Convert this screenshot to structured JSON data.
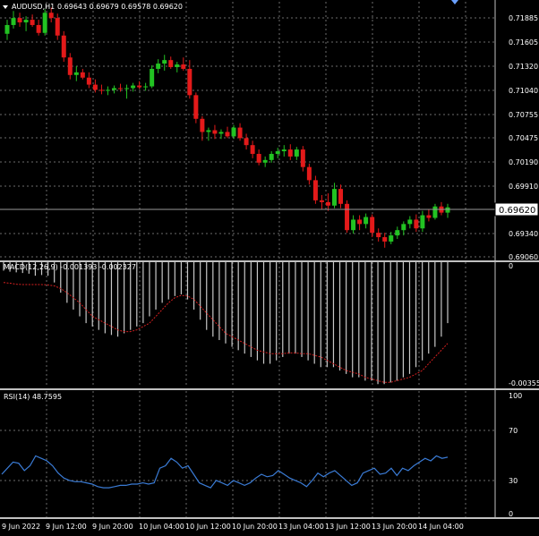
{
  "window": {
    "symbol": "AUDUSD,H1",
    "ohlc": "0.69643 0.69679 0.69578 0.69620",
    "current_price": "0.69620"
  },
  "colors": {
    "background": "#000000",
    "grid": "#6b6b6b",
    "bull": "#22c322",
    "bear": "#e31a1a",
    "macd_hist": "#c8c8c8",
    "macd_signal": "#d42020",
    "rsi_line": "#3a7bd5",
    "price_line": "#9a9a9a"
  },
  "price_axis": [
    "0.71885",
    "0.71605",
    "0.71320",
    "0.71040",
    "0.70755",
    "0.70475",
    "0.70190",
    "0.69910",
    "0.69340",
    "0.69060"
  ],
  "time_axis": [
    "9 Jun 2022",
    "9 Jun 12:00",
    "9 Jun 20:00",
    "10 Jun 04:00",
    "10 Jun 12:00",
    "10 Jun 20:00",
    "13 Jun 04:00",
    "13 Jun 12:00",
    "13 Jun 20:00",
    "14 Jun 04:00"
  ],
  "macd": {
    "label": "MACD(12,26,9) -0.001393 -0.002327",
    "top_label": "0",
    "bottom_label": "-0.00355"
  },
  "rsi": {
    "label": "RSI(14) 48.7595",
    "levels": [
      "100",
      "70",
      "30",
      "0"
    ]
  },
  "chart_data": [
    {
      "type": "candlestick",
      "title": "AUDUSD,H1",
      "ylim": [
        0.69035,
        0.71985
      ],
      "candles": [
        {
          "o": 0.7162,
          "h": 0.7178,
          "l": 0.7155,
          "c": 0.7172
        },
        {
          "o": 0.7172,
          "h": 0.7188,
          "l": 0.7168,
          "c": 0.718
        },
        {
          "o": 0.718,
          "h": 0.7186,
          "l": 0.717,
          "c": 0.7175
        },
        {
          "o": 0.7175,
          "h": 0.7182,
          "l": 0.7165,
          "c": 0.7178
        },
        {
          "o": 0.7178,
          "h": 0.7184,
          "l": 0.717,
          "c": 0.7172
        },
        {
          "o": 0.7172,
          "h": 0.7178,
          "l": 0.716,
          "c": 0.7163
        },
        {
          "o": 0.7163,
          "h": 0.719,
          "l": 0.716,
          "c": 0.7186
        },
        {
          "o": 0.7186,
          "h": 0.7192,
          "l": 0.7175,
          "c": 0.718
        },
        {
          "o": 0.718,
          "h": 0.7185,
          "l": 0.7155,
          "c": 0.716
        },
        {
          "o": 0.716,
          "h": 0.7165,
          "l": 0.713,
          "c": 0.7135
        },
        {
          "o": 0.7135,
          "h": 0.714,
          "l": 0.711,
          "c": 0.7115
        },
        {
          "o": 0.7115,
          "h": 0.7125,
          "l": 0.7108,
          "c": 0.7118
        },
        {
          "o": 0.7118,
          "h": 0.7122,
          "l": 0.711,
          "c": 0.7112
        },
        {
          "o": 0.7112,
          "h": 0.7118,
          "l": 0.71,
          "c": 0.7104
        },
        {
          "o": 0.7104,
          "h": 0.711,
          "l": 0.7095,
          "c": 0.7098
        },
        {
          "o": 0.7098,
          "h": 0.7104,
          "l": 0.7093,
          "c": 0.7097
        },
        {
          "o": 0.7097,
          "h": 0.7102,
          "l": 0.7092,
          "c": 0.7098
        },
        {
          "o": 0.7098,
          "h": 0.7103,
          "l": 0.7094,
          "c": 0.71
        },
        {
          "o": 0.71,
          "h": 0.7105,
          "l": 0.7096,
          "c": 0.7099
        },
        {
          "o": 0.7099,
          "h": 0.7104,
          "l": 0.7088,
          "c": 0.71
        },
        {
          "o": 0.71,
          "h": 0.7106,
          "l": 0.7096,
          "c": 0.7103
        },
        {
          "o": 0.7103,
          "h": 0.7108,
          "l": 0.7099,
          "c": 0.7101
        },
        {
          "o": 0.7101,
          "h": 0.7106,
          "l": 0.7097,
          "c": 0.7102
        },
        {
          "o": 0.7102,
          "h": 0.7126,
          "l": 0.71,
          "c": 0.7122
        },
        {
          "o": 0.7122,
          "h": 0.7133,
          "l": 0.7117,
          "c": 0.7128
        },
        {
          "o": 0.7128,
          "h": 0.7138,
          "l": 0.712,
          "c": 0.7132
        },
        {
          "o": 0.7132,
          "h": 0.7136,
          "l": 0.7122,
          "c": 0.7124
        },
        {
          "o": 0.7124,
          "h": 0.713,
          "l": 0.7118,
          "c": 0.7127
        },
        {
          "o": 0.7127,
          "h": 0.7135,
          "l": 0.712,
          "c": 0.7122
        },
        {
          "o": 0.7122,
          "h": 0.7132,
          "l": 0.7088,
          "c": 0.7092
        },
        {
          "o": 0.7092,
          "h": 0.7095,
          "l": 0.706,
          "c": 0.7065
        },
        {
          "o": 0.7065,
          "h": 0.7068,
          "l": 0.704,
          "c": 0.705
        },
        {
          "o": 0.705,
          "h": 0.7055,
          "l": 0.704,
          "c": 0.7052
        },
        {
          "o": 0.7052,
          "h": 0.7058,
          "l": 0.7042,
          "c": 0.7048
        },
        {
          "o": 0.7048,
          "h": 0.7053,
          "l": 0.7042,
          "c": 0.705
        },
        {
          "o": 0.705,
          "h": 0.7056,
          "l": 0.7043,
          "c": 0.7045
        },
        {
          "o": 0.7045,
          "h": 0.7058,
          "l": 0.7042,
          "c": 0.7055
        },
        {
          "o": 0.7055,
          "h": 0.706,
          "l": 0.704,
          "c": 0.7043
        },
        {
          "o": 0.7043,
          "h": 0.7048,
          "l": 0.703,
          "c": 0.7035
        },
        {
          "o": 0.7035,
          "h": 0.704,
          "l": 0.702,
          "c": 0.7025
        },
        {
          "o": 0.7025,
          "h": 0.703,
          "l": 0.7012,
          "c": 0.7015
        },
        {
          "o": 0.7015,
          "h": 0.7022,
          "l": 0.701,
          "c": 0.7018
        },
        {
          "o": 0.7018,
          "h": 0.7028,
          "l": 0.7015,
          "c": 0.7025
        },
        {
          "o": 0.7025,
          "h": 0.7032,
          "l": 0.702,
          "c": 0.7028
        },
        {
          "o": 0.7028,
          "h": 0.7035,
          "l": 0.7022,
          "c": 0.703
        },
        {
          "o": 0.703,
          "h": 0.7036,
          "l": 0.7018,
          "c": 0.7022
        },
        {
          "o": 0.7022,
          "h": 0.7033,
          "l": 0.7018,
          "c": 0.703
        },
        {
          "o": 0.703,
          "h": 0.7034,
          "l": 0.7005,
          "c": 0.701
        },
        {
          "o": 0.701,
          "h": 0.7014,
          "l": 0.699,
          "c": 0.6995
        },
        {
          "o": 0.6995,
          "h": 0.7,
          "l": 0.6968,
          "c": 0.6972
        },
        {
          "o": 0.6972,
          "h": 0.6978,
          "l": 0.6962,
          "c": 0.697
        },
        {
          "o": 0.697,
          "h": 0.698,
          "l": 0.696,
          "c": 0.6966
        },
        {
          "o": 0.6966,
          "h": 0.6992,
          "l": 0.6963,
          "c": 0.6985
        },
        {
          "o": 0.6985,
          "h": 0.699,
          "l": 0.6963,
          "c": 0.6968
        },
        {
          "o": 0.6968,
          "h": 0.6972,
          "l": 0.6935,
          "c": 0.6938
        },
        {
          "o": 0.6938,
          "h": 0.6955,
          "l": 0.6934,
          "c": 0.695
        },
        {
          "o": 0.695,
          "h": 0.6955,
          "l": 0.6938,
          "c": 0.6945
        },
        {
          "o": 0.6945,
          "h": 0.6957,
          "l": 0.694,
          "c": 0.6953
        },
        {
          "o": 0.6953,
          "h": 0.6956,
          "l": 0.693,
          "c": 0.6935
        },
        {
          "o": 0.6935,
          "h": 0.694,
          "l": 0.6925,
          "c": 0.693
        },
        {
          "o": 0.693,
          "h": 0.6935,
          "l": 0.6918,
          "c": 0.6925
        },
        {
          "o": 0.6925,
          "h": 0.6936,
          "l": 0.6922,
          "c": 0.6932
        },
        {
          "o": 0.6932,
          "h": 0.6942,
          "l": 0.6928,
          "c": 0.6938
        },
        {
          "o": 0.6938,
          "h": 0.6948,
          "l": 0.6932,
          "c": 0.6945
        },
        {
          "o": 0.6945,
          "h": 0.6954,
          "l": 0.694,
          "c": 0.695
        },
        {
          "o": 0.695,
          "h": 0.6956,
          "l": 0.6936,
          "c": 0.694
        },
        {
          "o": 0.694,
          "h": 0.696,
          "l": 0.6936,
          "c": 0.6955
        },
        {
          "o": 0.6955,
          "h": 0.6962,
          "l": 0.6948,
          "c": 0.6952
        },
        {
          "o": 0.6952,
          "h": 0.6968,
          "l": 0.695,
          "c": 0.6965
        },
        {
          "o": 0.6965,
          "h": 0.697,
          "l": 0.6955,
          "c": 0.6958
        },
        {
          "o": 0.6958,
          "h": 0.6968,
          "l": 0.6952,
          "c": 0.6964
        }
      ]
    },
    {
      "type": "bar",
      "title": "MACD(12,26,9)",
      "ylim": [
        -0.0037,
        0.0
      ],
      "values": [
        -0.00025,
        -0.00028,
        -0.0003,
        -0.00032,
        -0.00034,
        -0.0004,
        -0.00038,
        -0.0004,
        -0.0006,
        -0.0009,
        -0.0012,
        -0.0014,
        -0.0016,
        -0.0018,
        -0.0019,
        -0.002,
        -0.0021,
        -0.00215,
        -0.0022,
        -0.0021,
        -0.002,
        -0.0019,
        -0.0018,
        -0.0016,
        -0.0014,
        -0.0012,
        -0.0011,
        -0.001,
        -0.00095,
        -0.0011,
        -0.0014,
        -0.0017,
        -0.002,
        -0.0022,
        -0.0023,
        -0.0024,
        -0.0025,
        -0.0026,
        -0.0027,
        -0.0028,
        -0.0029,
        -0.003,
        -0.003,
        -0.0029,
        -0.0028,
        -0.0027,
        -0.0027,
        -0.0028,
        -0.0029,
        -0.003,
        -0.0031,
        -0.0031,
        -0.0031,
        -0.0032,
        -0.0033,
        -0.0034,
        -0.0034,
        -0.0035,
        -0.0035,
        -0.0036,
        -0.0036,
        -0.00355,
        -0.0035,
        -0.0034,
        -0.0033,
        -0.0031,
        -0.0029,
        -0.0027,
        -0.0025,
        -0.0022,
        -0.0018
      ],
      "signal": [
        -0.0006,
        -0.00062,
        -0.00065,
        -0.00066,
        -0.00066,
        -0.00066,
        -0.00066,
        -0.00067,
        -0.0007,
        -0.00078,
        -0.0009,
        -0.00105,
        -0.0012,
        -0.0014,
        -0.0016,
        -0.0017,
        -0.0018,
        -0.0019,
        -0.002,
        -0.00205,
        -0.00205,
        -0.002,
        -0.0019,
        -0.0018,
        -0.0016,
        -0.0014,
        -0.0012,
        -0.00105,
        -0.00098,
        -0.001,
        -0.0011,
        -0.0013,
        -0.0015,
        -0.0017,
        -0.0019,
        -0.0021,
        -0.0022,
        -0.0023,
        -0.0024,
        -0.0025,
        -0.0026,
        -0.00265,
        -0.0027,
        -0.0027,
        -0.0027,
        -0.00268,
        -0.00268,
        -0.0027,
        -0.0027,
        -0.00275,
        -0.0028,
        -0.0029,
        -0.003,
        -0.0031,
        -0.0032,
        -0.00325,
        -0.0033,
        -0.0034,
        -0.00345,
        -0.0035,
        -0.00355,
        -0.00355,
        -0.0035,
        -0.00345,
        -0.0034,
        -0.0033,
        -0.0032,
        -0.003,
        -0.0028,
        -0.0026,
        -0.0024
      ]
    },
    {
      "type": "line",
      "title": "RSI(14)",
      "ylim": [
        0,
        100
      ],
      "values": [
        35,
        40,
        45,
        44,
        38,
        42,
        50,
        48,
        46,
        42,
        36,
        32,
        30,
        29,
        29,
        28,
        27,
        25,
        24,
        24,
        25,
        26,
        26,
        27,
        27,
        28,
        27,
        28,
        40,
        42,
        48,
        45,
        40,
        42,
        35,
        28,
        26,
        24,
        30,
        28,
        26,
        30,
        28,
        26,
        28,
        32,
        35,
        33,
        34,
        38,
        35,
        32,
        30,
        28,
        25,
        30,
        36,
        33,
        36,
        38,
        34,
        30,
        26,
        28,
        36,
        38,
        40,
        35,
        36,
        40,
        34,
        40,
        38,
        42,
        45,
        48,
        46,
        50,
        48,
        49
      ]
    }
  ]
}
